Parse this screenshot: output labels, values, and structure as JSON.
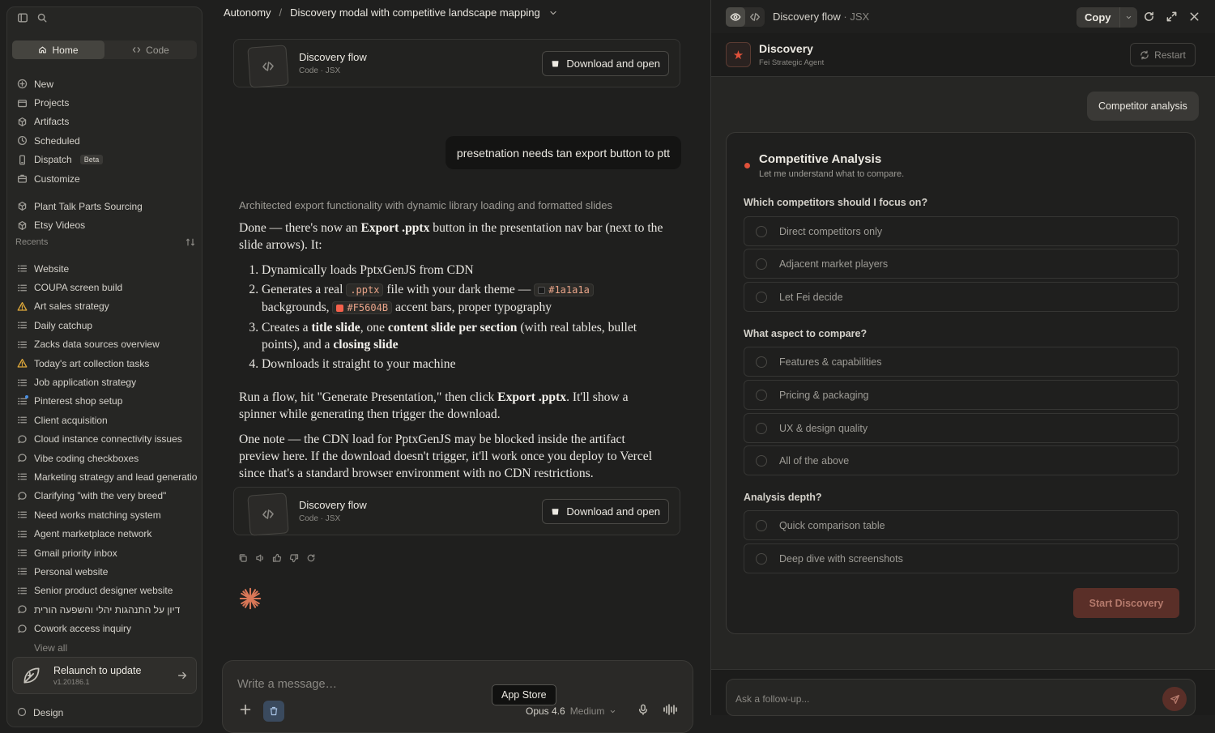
{
  "sidebar": {
    "tabs": {
      "home": "Home",
      "code": "Code"
    },
    "nav": [
      {
        "label": "New",
        "icon": "plus-icon"
      },
      {
        "label": "Projects",
        "icon": "folder-icon"
      },
      {
        "label": "Artifacts",
        "icon": "artifacts-icon"
      },
      {
        "label": "Scheduled",
        "icon": "clock-icon"
      },
      {
        "label": "Dispatch",
        "icon": "phone-icon",
        "badge": "Beta"
      },
      {
        "label": "Customize",
        "icon": "briefcase-icon"
      }
    ],
    "pinned": [
      {
        "label": "Plant Talk Parts Sourcing",
        "icon": "artifacts-icon"
      },
      {
        "label": "Etsy Videos",
        "icon": "artifacts-icon"
      }
    ],
    "recents_label": "Recents",
    "recents": [
      {
        "label": "Website",
        "icon": "list-icon"
      },
      {
        "label": "COUPA screen build",
        "icon": "list-icon"
      },
      {
        "label": "Art sales strategy",
        "icon": "warning-icon"
      },
      {
        "label": "Daily catchup",
        "icon": "list-icon"
      },
      {
        "label": "Zacks data sources overview",
        "icon": "list-icon"
      },
      {
        "label": "Today's art collection tasks",
        "icon": "warning-icon"
      },
      {
        "label": "Job application strategy",
        "icon": "list-icon"
      },
      {
        "label": "Pinterest shop setup",
        "icon": "list-icon"
      },
      {
        "label": "Client acquisition",
        "icon": "list-icon"
      },
      {
        "label": "Cloud instance connectivity issues",
        "icon": "chat-icon"
      },
      {
        "label": "Vibe coding checkboxes",
        "icon": "chat-icon"
      },
      {
        "label": "Marketing strategy and lead generation",
        "icon": "list-icon"
      },
      {
        "label": "Clarifying \"with the very breed\"",
        "icon": "chat-icon"
      },
      {
        "label": "Need works matching system",
        "icon": "list-icon"
      },
      {
        "label": "Agent marketplace network",
        "icon": "list-icon"
      },
      {
        "label": "Gmail priority inbox",
        "icon": "list-icon"
      },
      {
        "label": "Personal website",
        "icon": "list-icon"
      },
      {
        "label": "Senior product designer website",
        "icon": "list-icon"
      },
      {
        "label": "דיון על התנהגות יהלי והשפעה הורית",
        "icon": "chat-icon"
      },
      {
        "label": "Cowork access inquiry",
        "icon": "chat-icon"
      }
    ],
    "view_all": "View all",
    "relaunch": {
      "title": "Relaunch to update",
      "version": "v1.20186.1"
    },
    "bottom_item": "Design"
  },
  "main": {
    "breadcrumb": {
      "root": "Autonomy",
      "separator": "/",
      "title": "Discovery modal with competitive landscape mapping"
    },
    "artifact": {
      "name": "Discovery flow",
      "meta": "Code · JSX",
      "download": "Download and open"
    },
    "user_message": "presetnation needs tan export button to ptt",
    "thinking": "Architected export functionality with dynamic library loading and formatted slides",
    "answer": {
      "p1_a": "Done — there's now an ",
      "p1_b": "Export .pptx",
      "p1_c": " button in the presentation nav bar (next to the slide arrows). It:",
      "li1": "Dynamically loads PptxGenJS from CDN",
      "li2_a": "Generates a real ",
      "li2_code": ".pptx",
      "li2_b": " file with your dark theme — ",
      "li2_c1": "#1a1a1a",
      "li2_c": " backgrounds, ",
      "li2_c2": "#F5604B",
      "li2_d": " accent bars, proper typography",
      "li3_a": "Creates a ",
      "li3_b": "title slide",
      "li3_c": ", one ",
      "li3_d": "content slide per section",
      "li3_e": " (with real tables, bullet points), and a ",
      "li3_f": "closing slide",
      "li4": "Downloads it straight to your machine",
      "p2_a": "Run a flow, hit \"Generate Presentation,\" then click ",
      "p2_b": "Export .pptx",
      "p2_c": ". It'll show a spinner while generating then trigger the download.",
      "p3": "One note — the CDN load for PptxGenJS may be blocked inside the artifact preview here. If the download doesn't trigger, it'll work once you deploy to Vercel since that's a standard browser environment with no CDN restrictions."
    },
    "swatch_dark": "#1a1a1a",
    "swatch_accent": "#F5604B",
    "composer": {
      "placeholder": "Write a message…",
      "model": "Opus 4.6",
      "effort": "Medium"
    },
    "tooltip": "App Store"
  },
  "panel": {
    "title": "Discovery flow",
    "title_meta": "· JSX",
    "copy": "Copy",
    "app": {
      "name": "Discovery",
      "subtitle": "Fei Strategic Agent",
      "restart": "Restart"
    },
    "chip": "Competitor analysis",
    "card": {
      "heading": "Competitive Analysis",
      "subheading": "Let me understand what to compare.",
      "q1": "Which competitors should I focus on?",
      "q1_options": [
        "Direct competitors only",
        "Adjacent market players",
        "Let Fei decide"
      ],
      "q2": "What aspect to compare?",
      "q2_options": [
        "Features & capabilities",
        "Pricing & packaging",
        "UX & design quality",
        "All of the above"
      ],
      "q3": "Analysis depth?",
      "q3_options": [
        "Quick comparison table",
        "Deep dive with screenshots"
      ],
      "start": "Start Discovery"
    },
    "followup_placeholder": "Ask a follow-up...",
    "accent": "#e0513a"
  }
}
